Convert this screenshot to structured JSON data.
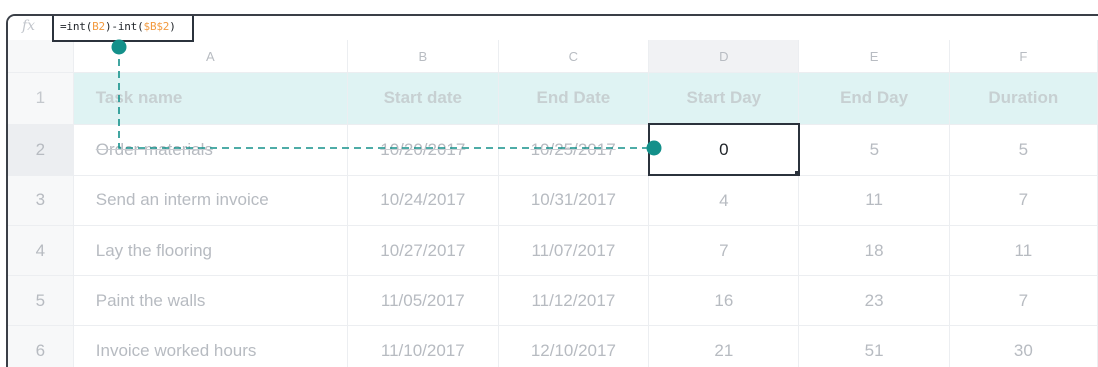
{
  "formula_bar": {
    "fx_icon": "function-icon",
    "formula": {
      "prefix1": "=int(",
      "ref1": "B2",
      "mid": ")-int(",
      "ref2": "$B$2",
      "suffix": ")"
    }
  },
  "columns": [
    "A",
    "B",
    "C",
    "D",
    "E",
    "F"
  ],
  "header_row": {
    "number": "1",
    "cells": [
      "Task name",
      "Start date",
      "End Date",
      "Start Day",
      "End Day",
      "Duration"
    ]
  },
  "rows": [
    {
      "number": "2",
      "cells": [
        "Order materials",
        "10/20/2017",
        "10/25/2017",
        "0",
        "5",
        "5"
      ]
    },
    {
      "number": "3",
      "cells": [
        "Send an interm invoice",
        "10/24/2017",
        "10/31/2017",
        "4",
        "11",
        "7"
      ]
    },
    {
      "number": "4",
      "cells": [
        "Lay the flooring",
        "10/27/2017",
        "11/07/2017",
        "7",
        "18",
        "11"
      ]
    },
    {
      "number": "5",
      "cells": [
        "Paint the walls",
        "11/05/2017",
        "11/12/2017",
        "16",
        "23",
        "7"
      ]
    },
    {
      "number": "6",
      "cells": [
        "Invoice worked hours",
        "11/10/2017",
        "12/10/2017",
        "21",
        "51",
        "30"
      ]
    }
  ],
  "colors": {
    "header_fill": "#dff3f3",
    "connector": "#13908a",
    "reference_text": "#f29a3f",
    "selection_border": "#2b323c"
  }
}
